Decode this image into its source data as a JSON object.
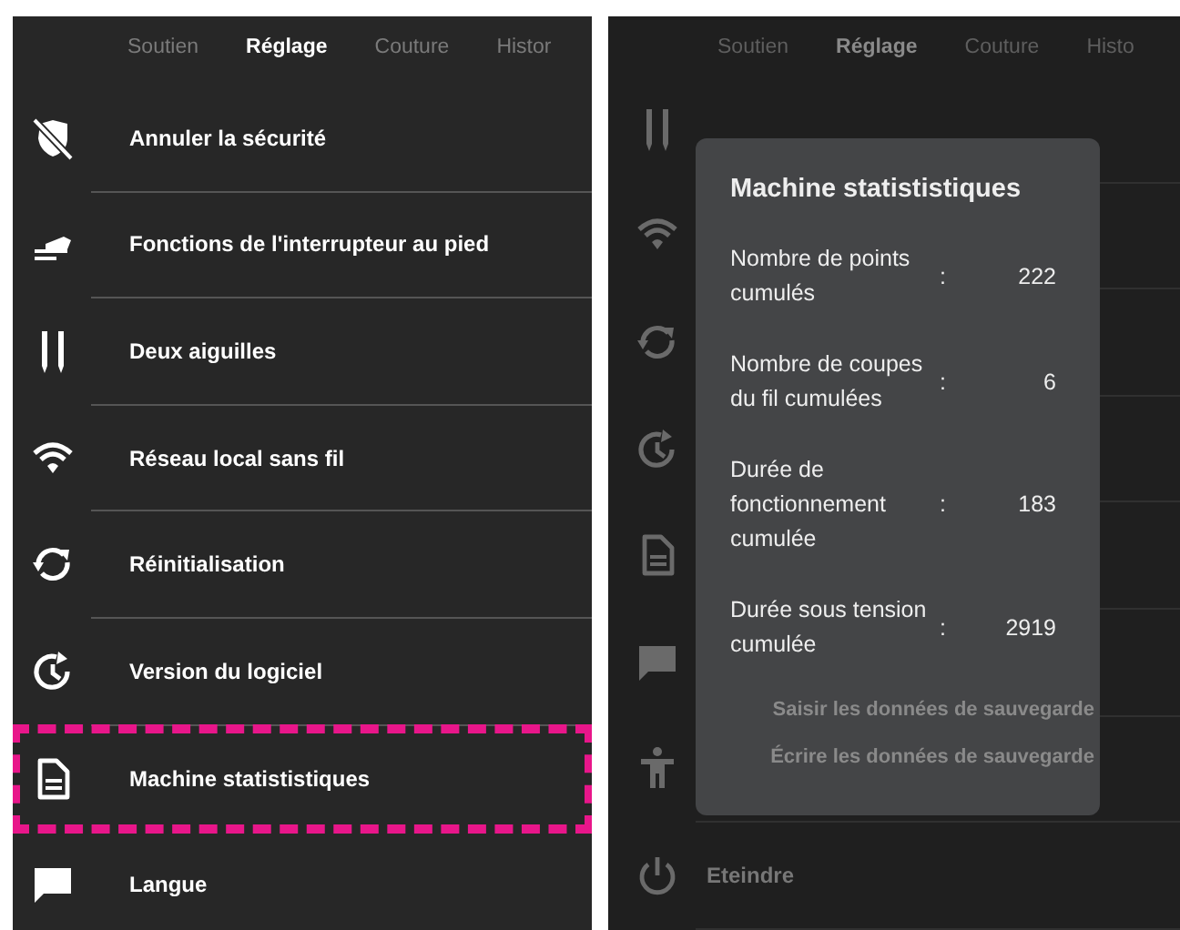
{
  "screens": [
    {
      "dimmed": false,
      "tabs": [
        {
          "label": "Soutien",
          "selected": false
        },
        {
          "label": "Réglage",
          "selected": true
        },
        {
          "label": "Couture",
          "selected": false
        },
        {
          "label": "Histor",
          "selected": false
        }
      ],
      "items": [
        {
          "kind": "shield-off",
          "label": "Annuler la sécurité",
          "highlighted": false
        },
        {
          "kind": "pedal",
          "label": "Fonctions de l'interrupteur au pied",
          "highlighted": false
        },
        {
          "kind": "needles",
          "label": "Deux aiguilles",
          "highlighted": false
        },
        {
          "kind": "wifi",
          "label": "Réseau local sans fil",
          "highlighted": false
        },
        {
          "kind": "reset",
          "label": "Réinitialisation",
          "highlighted": false
        },
        {
          "kind": "version",
          "label": "Version du logiciel",
          "highlighted": false
        },
        {
          "kind": "document",
          "label": "Machine statististiques",
          "highlighted": true
        },
        {
          "kind": "chat",
          "label": "Langue",
          "highlighted": false
        }
      ]
    },
    {
      "dimmed": true,
      "tabs": [
        {
          "label": "Soutien",
          "selected": false
        },
        {
          "label": "Réglage",
          "selected": true
        },
        {
          "label": "Couture",
          "selected": false
        },
        {
          "label": "Histo",
          "selected": false
        }
      ],
      "items": [
        {
          "kind": "needles",
          "highlighted": false
        },
        {
          "kind": "wifi",
          "highlighted": false
        },
        {
          "kind": "reset",
          "highlighted": false
        },
        {
          "kind": "version",
          "highlighted": false
        },
        {
          "kind": "document",
          "highlighted": false
        },
        {
          "kind": "chat",
          "highlighted": false
        },
        {
          "kind": "person",
          "highlighted": false
        },
        {
          "kind": "power",
          "label": "Eteindre",
          "highlighted": false
        }
      ]
    }
  ],
  "dialog": {
    "title": "Machine statististiques",
    "rows": [
      {
        "label": "Nombre de points cumulés",
        "value": "222"
      },
      {
        "label": "Nombre de coupes du fil cumulées",
        "value": "6"
      },
      {
        "label": "Durée de fonctionnement cumulée",
        "value": "183"
      },
      {
        "label": "Durée sous tension cumulée",
        "value": "2919"
      }
    ],
    "separator": ":",
    "buttons": [
      "Saisir les données de sauvegarde",
      "Écrire les données de sauvegarde"
    ]
  }
}
